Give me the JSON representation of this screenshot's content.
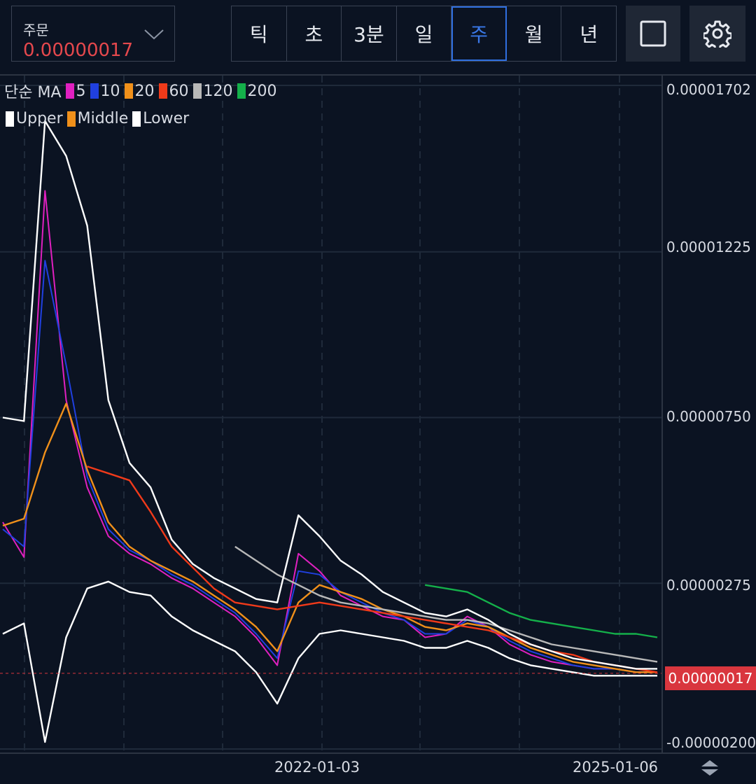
{
  "toolbar": {
    "order_label": "주문",
    "order_value": "0.00000017",
    "timeframes": [
      "틱",
      "초",
      "3분",
      "일",
      "주",
      "월",
      "년"
    ],
    "active_timeframe": "주"
  },
  "legend": {
    "ma_title": "단순 MA",
    "ma_items": [
      {
        "label": "5",
        "color": "#e020c0"
      },
      {
        "label": "10",
        "color": "#2040e0"
      },
      {
        "label": "20",
        "color": "#f0901a"
      },
      {
        "label": "60",
        "color": "#f03a1a"
      },
      {
        "label": "120",
        "color": "#b8b8b8"
      },
      {
        "label": "200",
        "color": "#14b04a"
      }
    ],
    "bb_items": [
      {
        "label": "Upper",
        "color": "#ffffff"
      },
      {
        "label": "Middle",
        "color": "#f0901a"
      },
      {
        "label": "Lower",
        "color": "#ffffff"
      }
    ]
  },
  "chart_data": {
    "type": "line",
    "y_tick_labels": [
      "0.00001702",
      "0.00001225",
      "0.00000750",
      "0.00000275",
      "-0.00000200"
    ],
    "ylim": [
      -2e-06,
      1.702e-05
    ],
    "x_tick_labels": [
      "2022-01-03",
      "2025-01-06"
    ],
    "current_price": "0.00000017",
    "grid": true,
    "series": [
      {
        "name": "5",
        "color": "#e020c0",
        "values": [
          4.5e-06,
          3.5e-06,
          1.4e-05,
          8e-06,
          5.5e-06,
          4.1e-06,
          3.6e-06,
          3.3e-06,
          2.9e-06,
          2.6e-06,
          2.2e-06,
          1.8e-06,
          1.2e-06,
          4e-07,
          3.6e-06,
          3.1e-06,
          2.4e-06,
          2.1e-06,
          1.8e-06,
          1.7e-06,
          1.2e-06,
          1.3e-06,
          1.8e-06,
          1.5e-06,
          1e-06,
          7e-07,
          5e-07,
          4e-07,
          3e-07,
          3e-07,
          2e-07,
          2e-07
        ]
      },
      {
        "name": "10",
        "color": "#2040e0",
        "values": [
          4.3e-06,
          3.8e-06,
          1.2e-05,
          9e-06,
          5.8e-06,
          4.3e-06,
          3.7e-06,
          3.4e-06,
          3e-06,
          2.7e-06,
          2.3e-06,
          1.9e-06,
          1.3e-06,
          6e-07,
          3.1e-06,
          3e-06,
          2.5e-06,
          2.2e-06,
          1.9e-06,
          1.7e-06,
          1.3e-06,
          1.3e-06,
          1.7e-06,
          1.5e-06,
          1.1e-06,
          8e-07,
          6e-07,
          4e-07,
          3e-07,
          3e-07,
          2e-07,
          2e-07
        ]
      },
      {
        "name": "20",
        "color": "#f0901a",
        "values": [
          4.4e-06,
          4.6e-06,
          6.5e-06,
          7.9e-06,
          6e-06,
          4.5e-06,
          3.8e-06,
          3.4e-06,
          3.1e-06,
          2.8e-06,
          2.4e-06,
          2e-06,
          1.5e-06,
          8e-07,
          2.2e-06,
          2.7e-06,
          2.5e-06,
          2.3e-06,
          2e-06,
          1.8e-06,
          1.5e-06,
          1.4e-06,
          1.6e-06,
          1.5e-06,
          1.2e-06,
          9e-07,
          7e-07,
          5e-07,
          4e-07,
          3e-07,
          2e-07,
          2e-07
        ]
      },
      {
        "name": "60",
        "color": "#f03a1a",
        "values": [
          null,
          null,
          null,
          null,
          6.1e-06,
          5.9e-06,
          5.7e-06,
          4.8e-06,
          3.8e-06,
          3.2e-06,
          2.6e-06,
          2.2e-06,
          2.1e-06,
          2e-06,
          2.1e-06,
          2.2e-06,
          2.1e-06,
          2e-06,
          1.9e-06,
          1.8e-06,
          1.7e-06,
          1.6e-06,
          1.5e-06,
          1.4e-06,
          1.2e-06,
          1e-06,
          8e-07,
          7e-07,
          5e-07,
          4e-07,
          3e-07,
          2e-07
        ]
      },
      {
        "name": "120",
        "color": "#b8b8b8",
        "values": [
          null,
          null,
          null,
          null,
          null,
          null,
          null,
          null,
          null,
          null,
          null,
          3.8e-06,
          3.4e-06,
          3e-06,
          2.7e-06,
          2.4e-06,
          2.2e-06,
          2.1e-06,
          2e-06,
          1.9e-06,
          1.8e-06,
          1.7e-06,
          1.7e-06,
          1.6e-06,
          1.4e-06,
          1.2e-06,
          1e-06,
          9e-07,
          8e-07,
          7e-07,
          6e-07,
          5e-07
        ]
      },
      {
        "name": "200",
        "color": "#14b04a",
        "values": [
          null,
          null,
          null,
          null,
          null,
          null,
          null,
          null,
          null,
          null,
          null,
          null,
          null,
          null,
          null,
          null,
          null,
          null,
          null,
          null,
          2.7e-06,
          2.6e-06,
          2.5e-06,
          2.2e-06,
          1.9e-06,
          1.7e-06,
          1.6e-06,
          1.5e-06,
          1.4e-06,
          1.3e-06,
          1.3e-06,
          1.2e-06
        ]
      },
      {
        "name": "Upper",
        "color": "#ffffff",
        "values": [
          7.5e-06,
          7.4e-06,
          1.6e-05,
          1.5e-05,
          1.3e-05,
          8e-06,
          6.2e-06,
          5.5e-06,
          4e-06,
          3.3e-06,
          2.9e-06,
          2.6e-06,
          2.3e-06,
          2.2e-06,
          4.7e-06,
          4.1e-06,
          3.4e-06,
          3e-06,
          2.5e-06,
          2.2e-06,
          1.9e-06,
          1.8e-06,
          2e-06,
          1.7e-06,
          1.3e-06,
          1e-06,
          8e-07,
          6e-07,
          5e-07,
          4e-07,
          3e-07,
          3e-07
        ]
      },
      {
        "name": "Lower",
        "color": "#ffffff",
        "values": [
          1.3e-06,
          1.6e-06,
          -1.8e-06,
          1.2e-06,
          2.6e-06,
          2.8e-06,
          2.5e-06,
          2.4e-06,
          1.8e-06,
          1.4e-06,
          1.1e-06,
          8e-07,
          2e-07,
          -7e-07,
          6e-07,
          1.3e-06,
          1.4e-06,
          1.3e-06,
          1.2e-06,
          1.1e-06,
          9e-07,
          9e-07,
          1.1e-06,
          9e-07,
          6e-07,
          4e-07,
          3e-07,
          2e-07,
          1e-07,
          1e-07,
          1e-07,
          1e-07
        ]
      }
    ]
  }
}
